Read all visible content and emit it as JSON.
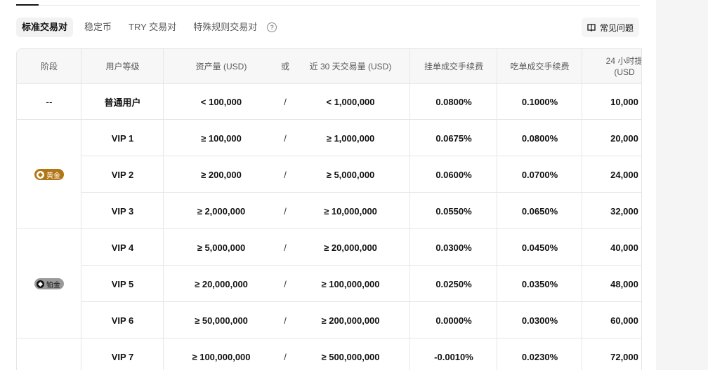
{
  "tabs": [
    {
      "label": "标准交易对",
      "active": true
    },
    {
      "label": "稳定币",
      "active": false
    },
    {
      "label": "TRY 交易对",
      "active": false
    },
    {
      "label": "特殊规则交易对",
      "active": false
    }
  ],
  "faq_label": "常见问题",
  "icons": {
    "help": "question-circle-icon",
    "faq": "book-icon",
    "tier_badge": "diamond-icon"
  },
  "colors": {
    "gold_badge": "#b27614",
    "platinum_badge": "#9a9a9a",
    "header_bg": "#f7f7f7",
    "border": "#e6e6e6"
  },
  "table": {
    "headers": {
      "stage": "阶段",
      "level": "用户等级",
      "assets": "资产量 (USD)",
      "or": "或",
      "volume": "近 30 天交易量 (USD)",
      "maker": "挂单成交手续费",
      "taker": "吃单成交手续费",
      "withdraw_line1": "24 小时提",
      "withdraw_line2": "(USD"
    },
    "stages": [
      {
        "label": "--",
        "badge": null
      },
      {
        "label": "黄金",
        "badge": "gold"
      },
      {
        "label": "铂金",
        "badge": "platinum"
      }
    ],
    "rows": [
      {
        "level": "普通用户",
        "assets": "< 100,000",
        "sep": "/",
        "volume": "< 1,000,000",
        "maker": "0.0800%",
        "taker": "0.1000%",
        "withdraw": "10,000"
      },
      {
        "level": "VIP 1",
        "assets": "≥ 100,000",
        "sep": "/",
        "volume": "≥ 1,000,000",
        "maker": "0.0675%",
        "taker": "0.0800%",
        "withdraw": "20,000"
      },
      {
        "level": "VIP 2",
        "assets": "≥ 200,000",
        "sep": "/",
        "volume": "≥ 5,000,000",
        "maker": "0.0600%",
        "taker": "0.0700%",
        "withdraw": "24,000"
      },
      {
        "level": "VIP 3",
        "assets": "≥ 2,000,000",
        "sep": "/",
        "volume": "≥ 10,000,000",
        "maker": "0.0550%",
        "taker": "0.0650%",
        "withdraw": "32,000"
      },
      {
        "level": "VIP 4",
        "assets": "≥ 5,000,000",
        "sep": "/",
        "volume": "≥ 20,000,000",
        "maker": "0.0300%",
        "taker": "0.0450%",
        "withdraw": "40,000"
      },
      {
        "level": "VIP 5",
        "assets": "≥ 20,000,000",
        "sep": "/",
        "volume": "≥ 100,000,000",
        "maker": "0.0250%",
        "taker": "0.0350%",
        "withdraw": "48,000"
      },
      {
        "level": "VIP 6",
        "assets": "≥ 50,000,000",
        "sep": "/",
        "volume": "≥ 200,000,000",
        "maker": "0.0000%",
        "taker": "0.0300%",
        "withdraw": "60,000"
      },
      {
        "level": "VIP 7",
        "assets": "≥ 100,000,000",
        "sep": "/",
        "volume": "≥ 500,000,000",
        "maker": "-0.0010%",
        "taker": "0.0230%",
        "withdraw": "72,000"
      }
    ]
  }
}
